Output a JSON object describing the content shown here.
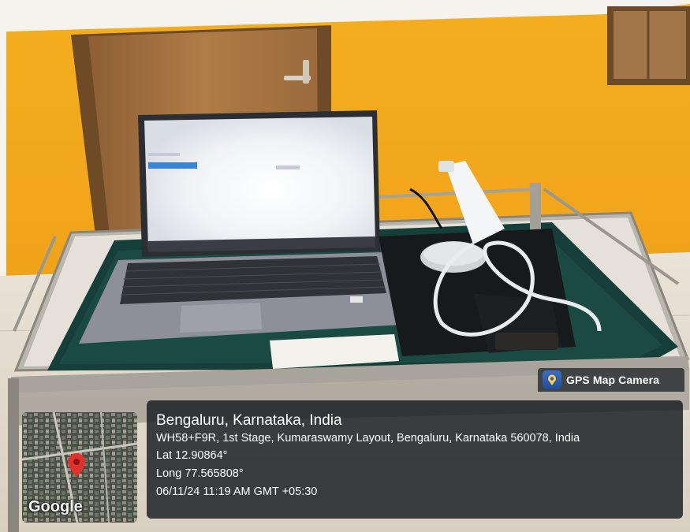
{
  "watermark": {
    "brand_label": "GPS Map Camera",
    "icon": "location-pin-camera-icon",
    "panel_color": "#161a1e"
  },
  "map_thumbnail": {
    "provider_label": "Google",
    "marker_icon": "map-marker-icon",
    "marker_color": "#e0322d"
  },
  "location": {
    "place": "Bengaluru, Karnataka, India",
    "address": "WH58+F9R, 1st Stage, Kumaraswamy Layout, Bengaluru, Karnataka 560078, India",
    "latitude": "Lat 12.90864°",
    "longitude": "Long 77.565808°",
    "timestamp": "06/11/24 11:19 AM GMT +05:30"
  },
  "scene": {
    "wall_color": "#f2a81c",
    "door_color": "#a6743f",
    "cloth_color": "#15403a",
    "laptop_icon": "laptop-icon",
    "device_icon": "handheld-scanner-icon"
  }
}
